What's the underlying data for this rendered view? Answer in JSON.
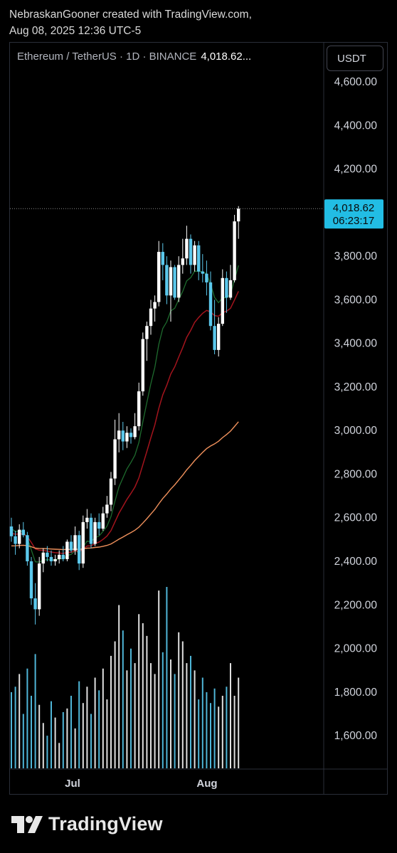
{
  "header": {
    "line1": "NebraskanGooner created with TradingView.com,",
    "line2": "Aug 08, 2025 12:36 UTC-5"
  },
  "symbol_bar": {
    "title": "Ethereum / TetherUS · 1D · BINANCE",
    "last_price": "4,018.62..."
  },
  "currency_button": "USDT",
  "brand": "TradingView",
  "colors": {
    "background": "#000000",
    "up": "#ffffff",
    "down": "#5bc8ec",
    "ma_fast": "#1e6b2e",
    "ma_mid": "#a3141d",
    "ma_slow": "#f0915c",
    "price_tag": "#22bde4"
  },
  "chart_data": {
    "type": "candlestick",
    "pair": "ETH/USDT",
    "timeframe": "1D",
    "exchange": "BINANCE",
    "x_ticks": [
      "Jul",
      "Aug"
    ],
    "y_ticks": [
      1600,
      1800,
      2000,
      2200,
      2400,
      2600,
      2800,
      3000,
      3200,
      3400,
      3600,
      3800,
      4000,
      4200,
      4400,
      4600
    ],
    "y_tick_labels": [
      "1,600.00",
      "1,800.00",
      "2,000.00",
      "2,200.00",
      "2,400.00",
      "2,600.00",
      "2,800.00",
      "3,000.00",
      "3,200.00",
      "3,400.00",
      "3,600.00",
      "3,800.00",
      "4,000.00",
      "4,200.00",
      "4,400.00",
      "4,600.00"
    ],
    "y_range": [
      1450,
      4780
    ],
    "last_price": "4,018.62",
    "countdown": "06:23:17",
    "candles": [
      {
        "o": 2560,
        "h": 2600,
        "l": 2490,
        "c": 2515
      },
      {
        "o": 2515,
        "h": 2540,
        "l": 2430,
        "c": 2480
      },
      {
        "o": 2480,
        "h": 2570,
        "l": 2460,
        "c": 2545
      },
      {
        "o": 2545,
        "h": 2580,
        "l": 2510,
        "c": 2520
      },
      {
        "o": 2520,
        "h": 2535,
        "l": 2380,
        "c": 2400
      },
      {
        "o": 2400,
        "h": 2420,
        "l": 2200,
        "c": 2230
      },
      {
        "o": 2230,
        "h": 2300,
        "l": 2110,
        "c": 2180
      },
      {
        "o": 2180,
        "h": 2420,
        "l": 2150,
        "c": 2390
      },
      {
        "o": 2390,
        "h": 2460,
        "l": 2350,
        "c": 2440
      },
      {
        "o": 2440,
        "h": 2470,
        "l": 2400,
        "c": 2420
      },
      {
        "o": 2420,
        "h": 2450,
        "l": 2380,
        "c": 2400
      },
      {
        "o": 2400,
        "h": 2430,
        "l": 2380,
        "c": 2410
      },
      {
        "o": 2410,
        "h": 2450,
        "l": 2390,
        "c": 2430
      },
      {
        "o": 2430,
        "h": 2470,
        "l": 2400,
        "c": 2410
      },
      {
        "o": 2410,
        "h": 2500,
        "l": 2400,
        "c": 2490
      },
      {
        "o": 2490,
        "h": 2520,
        "l": 2440,
        "c": 2450
      },
      {
        "o": 2450,
        "h": 2560,
        "l": 2430,
        "c": 2520
      },
      {
        "o": 2520,
        "h": 2540,
        "l": 2360,
        "c": 2390
      },
      {
        "o": 2390,
        "h": 2610,
        "l": 2370,
        "c": 2580
      },
      {
        "o": 2580,
        "h": 2640,
        "l": 2550,
        "c": 2600
      },
      {
        "o": 2600,
        "h": 2620,
        "l": 2460,
        "c": 2480
      },
      {
        "o": 2480,
        "h": 2600,
        "l": 2470,
        "c": 2580
      },
      {
        "o": 2580,
        "h": 2620,
        "l": 2520,
        "c": 2550
      },
      {
        "o": 2550,
        "h": 2650,
        "l": 2540,
        "c": 2620
      },
      {
        "o": 2620,
        "h": 2700,
        "l": 2600,
        "c": 2660
      },
      {
        "o": 2660,
        "h": 2810,
        "l": 2630,
        "c": 2780
      },
      {
        "o": 2780,
        "h": 3050,
        "l": 2750,
        "c": 2960
      },
      {
        "o": 2960,
        "h": 3080,
        "l": 2900,
        "c": 3000
      },
      {
        "o": 3000,
        "h": 3040,
        "l": 2910,
        "c": 2950
      },
      {
        "o": 2950,
        "h": 3020,
        "l": 2920,
        "c": 2990
      },
      {
        "o": 2990,
        "h": 3010,
        "l": 2940,
        "c": 2970
      },
      {
        "o": 2970,
        "h": 3080,
        "l": 2960,
        "c": 3020
      },
      {
        "o": 3020,
        "h": 3220,
        "l": 3000,
        "c": 3180
      },
      {
        "o": 3180,
        "h": 3450,
        "l": 3160,
        "c": 3420
      },
      {
        "o": 3420,
        "h": 3500,
        "l": 3320,
        "c": 3480
      },
      {
        "o": 3480,
        "h": 3600,
        "l": 3440,
        "c": 3560
      },
      {
        "o": 3560,
        "h": 3620,
        "l": 3500,
        "c": 3590
      },
      {
        "o": 3590,
        "h": 3870,
        "l": 3570,
        "c": 3820
      },
      {
        "o": 3820,
        "h": 3860,
        "l": 3690,
        "c": 3760
      },
      {
        "o": 3760,
        "h": 3800,
        "l": 3580,
        "c": 3620
      },
      {
        "o": 3620,
        "h": 3780,
        "l": 3500,
        "c": 3750
      },
      {
        "o": 3750,
        "h": 3760,
        "l": 3600,
        "c": 3610
      },
      {
        "o": 3610,
        "h": 3800,
        "l": 3590,
        "c": 3760
      },
      {
        "o": 3760,
        "h": 3880,
        "l": 3720,
        "c": 3790
      },
      {
        "o": 3790,
        "h": 3940,
        "l": 3760,
        "c": 3880
      },
      {
        "o": 3880,
        "h": 3900,
        "l": 3720,
        "c": 3760
      },
      {
        "o": 3760,
        "h": 3870,
        "l": 3730,
        "c": 3850
      },
      {
        "o": 3850,
        "h": 3870,
        "l": 3690,
        "c": 3730
      },
      {
        "o": 3730,
        "h": 3810,
        "l": 3680,
        "c": 3720
      },
      {
        "o": 3720,
        "h": 3780,
        "l": 3620,
        "c": 3680
      },
      {
        "o": 3680,
        "h": 3730,
        "l": 3460,
        "c": 3480
      },
      {
        "o": 3480,
        "h": 3600,
        "l": 3350,
        "c": 3370
      },
      {
        "o": 3370,
        "h": 3520,
        "l": 3340,
        "c": 3490
      },
      {
        "o": 3490,
        "h": 3740,
        "l": 3480,
        "c": 3700
      },
      {
        "o": 3700,
        "h": 3730,
        "l": 3540,
        "c": 3610
      },
      {
        "o": 3610,
        "h": 3760,
        "l": 3600,
        "c": 3690
      },
      {
        "o": 3690,
        "h": 3990,
        "l": 3680,
        "c": 3960
      },
      {
        "o": 3960,
        "h": 4030,
        "l": 3880,
        "c": 4018.62
      }
    ],
    "volume": [
      0.42,
      0.45,
      0.52,
      0.3,
      0.55,
      0.4,
      0.63,
      0.35,
      0.25,
      0.18,
      0.37,
      0.28,
      0.14,
      0.31,
      0.33,
      0.4,
      0.22,
      0.48,
      0.36,
      0.45,
      0.3,
      0.5,
      0.43,
      0.55,
      0.38,
      0.62,
      0.7,
      0.9,
      0.76,
      0.54,
      0.66,
      0.58,
      0.85,
      0.8,
      0.73,
      0.58,
      0.52,
      0.98,
      0.64,
      1.0,
      0.6,
      0.52,
      0.75,
      0.7,
      0.58,
      0.62,
      0.54,
      0.38,
      0.5,
      0.42,
      0.36,
      0.44,
      0.34,
      0.4,
      0.45,
      0.58,
      0.4,
      0.5
    ]
  }
}
